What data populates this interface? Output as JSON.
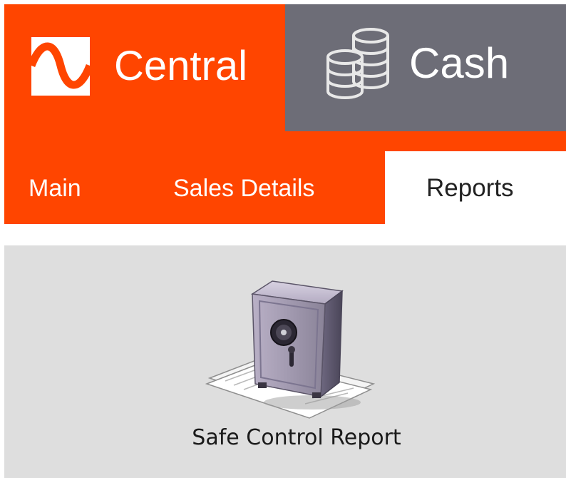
{
  "header": {
    "tabs": [
      {
        "label": "Central",
        "icon": "central-wave-logo-icon",
        "color": "#ff4500"
      },
      {
        "label": "Cash",
        "icon": "coins-icon",
        "color": "#6d6d77"
      }
    ]
  },
  "nav": {
    "items": [
      {
        "label": "Main"
      },
      {
        "label": "Sales Details"
      },
      {
        "label": "Reports",
        "active": true
      }
    ],
    "accent": "#ff4500"
  },
  "reports": {
    "items": [
      {
        "label": "Safe Control Report",
        "icon": "safe-icon"
      }
    ],
    "background": "#dedede"
  }
}
